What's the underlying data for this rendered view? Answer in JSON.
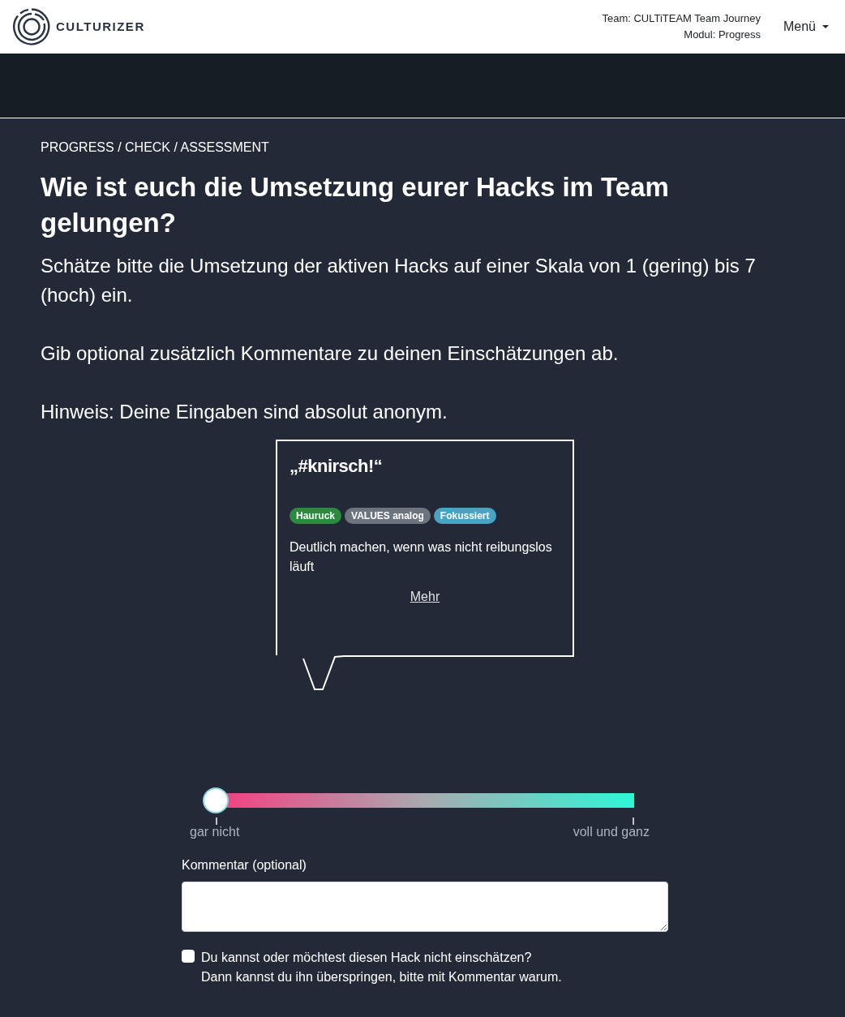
{
  "header": {
    "brand": "CULTURIZER",
    "team": "Team: CULTiTEAM Team Journey",
    "module": "Modul: Progress",
    "menu": "Menü"
  },
  "breadcrumb": "PROGRESS / CHECK / ASSESSMENT",
  "heading": "Wie ist euch die Umsetzung eurer Hacks im Team gelungen?",
  "paragraphs": [
    "Schätze bitte die Umsetzung der aktiven Hacks auf einer Skala von 1 (gering) bis 7 (hoch) ein.",
    "Gib optional zusätzlich Kommentare zu deinen Einschätzungen ab.",
    "Hinweis: Deine Eingaben sind absolut anonym."
  ],
  "hack_card": {
    "title": "„#knirsch!“",
    "tags": [
      {
        "label": "Hauruck",
        "color": "#2b8a3e"
      },
      {
        "label": "VALUES analog",
        "color": "#6c757d"
      },
      {
        "label": "Fokussiert",
        "color": "#4aa3c2"
      }
    ],
    "description": "Deutlich machen, wenn was nicht reibungslos läuft",
    "more_link": "Mehr"
  },
  "rating": {
    "level": 0,
    "min_label": "gar nicht",
    "max_label": "voll und ganz"
  },
  "comment": {
    "label": "Kommentar (optional)"
  },
  "skip": {
    "checked": false,
    "label_lines": [
      "Du kannst oder möchtest diesen Hack nicht einschätzen?",
      "Dann kannst du ihn überspringen, bitte mit Kommentar warum."
    ]
  }
}
